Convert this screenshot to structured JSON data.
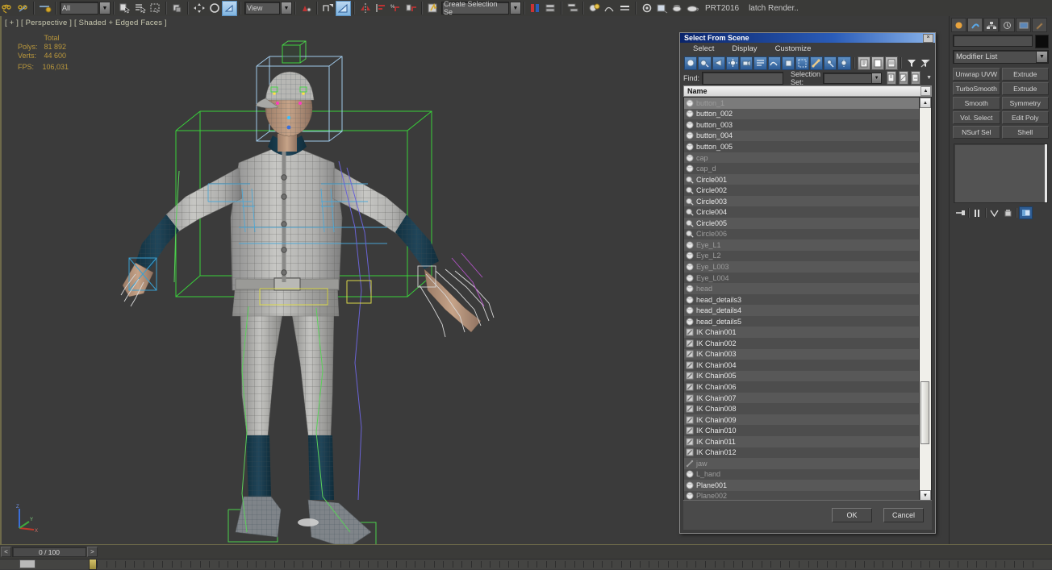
{
  "app": {
    "viewport_label": "[ + ] [ Perspective ] [ Shaded + Edged Faces ]",
    "stats": {
      "total_label": "Total",
      "polys_label": "Polys:",
      "polys_value": "81 892",
      "verts_label": "Verts:",
      "verts_value": "44 600",
      "fps_label": "FPS:",
      "fps_value": "106,031"
    }
  },
  "toolbar": {
    "filter_value": "All",
    "ref_coord_value": "View",
    "selection_set_value": "Create Selection Se",
    "render_preset": "PRT2016",
    "render_label": "latch Render..",
    "icons": [
      "undo-icon",
      "redo-icon",
      "select-link-icon",
      "unlink-icon",
      "bind-spacewarp-icon",
      "select-object-icon",
      "select-by-name-icon",
      "select-region-icon",
      "window-crossing-icon",
      "select-move-icon",
      "select-rotate-icon",
      "select-scale-icon",
      "mirror-icon",
      "align-icon",
      "layer-manager-icon",
      "graph-editor-icon",
      "schematic-view-icon",
      "material-editor-icon",
      "render-setup-icon",
      "render-frame-icon",
      "render-production-icon"
    ]
  },
  "command_panel": {
    "tabs": [
      "create-tab",
      "modify-tab",
      "hierarchy-tab",
      "motion-tab",
      "display-tab",
      "utilities-tab"
    ],
    "object_name": "",
    "modifier_list_label": "Modifier List",
    "stack_buttons": [
      "Unwrap UVW",
      "Extrude",
      "TurboSmooth",
      "Extrude",
      "Smooth",
      "Symmetry",
      "Vol. Select",
      "Edit Poly",
      "NSurf Sel",
      "Shell"
    ],
    "stack_tools": [
      "pin-stack-icon",
      "show-end-result-icon",
      "make-unique-icon",
      "remove-modifier-icon",
      "configure-sets-icon"
    ]
  },
  "dialog": {
    "title": "Select From Scene",
    "close_label": "×",
    "menu": [
      "Select",
      "Display",
      "Customize"
    ],
    "toolbar_icons": [
      "display-all-icon",
      "display-geometry-icon",
      "display-shapes-icon",
      "display-lights-icon",
      "display-cameras-icon",
      "display-helpers-icon",
      "display-spacewarps-icon",
      "display-groups-icon",
      "display-xrefs-icon",
      "display-bones-icon",
      "display-children-icon",
      "display-influences-icon",
      "list-types-icon",
      "sort-alphabetical-icon",
      "sort-by-type-icon",
      "filter-icon",
      "clear-filter-icon"
    ],
    "find_label": "Find:",
    "find_value": "",
    "find_placeholder": "",
    "selection_set_label": "Selection Set:",
    "selection_set_value": "",
    "column_header": "Name",
    "ok_label": "OK",
    "cancel_label": "Cancel",
    "items": [
      {
        "name": "button_1",
        "icon": "geometry-icon",
        "selected": true,
        "dim": true
      },
      {
        "name": "button_002",
        "icon": "geometry-icon",
        "selected": false,
        "dim": false
      },
      {
        "name": "button_003",
        "icon": "geometry-icon",
        "selected": false,
        "dim": false
      },
      {
        "name": "button_004",
        "icon": "geometry-icon",
        "selected": false,
        "dim": false
      },
      {
        "name": "button_005",
        "icon": "geometry-icon",
        "selected": false,
        "dim": false
      },
      {
        "name": "cap",
        "icon": "geometry-icon",
        "selected": false,
        "dim": true
      },
      {
        "name": "cap_d",
        "icon": "geometry-icon",
        "selected": false,
        "dim": true
      },
      {
        "name": "Circle001",
        "icon": "shape-icon",
        "selected": false,
        "dim": false
      },
      {
        "name": "Circle002",
        "icon": "shape-icon",
        "selected": false,
        "dim": false
      },
      {
        "name": "Circle003",
        "icon": "shape-icon",
        "selected": false,
        "dim": false
      },
      {
        "name": "Circle004",
        "icon": "shape-icon",
        "selected": false,
        "dim": false
      },
      {
        "name": "Circle005",
        "icon": "shape-icon",
        "selected": false,
        "dim": false
      },
      {
        "name": "Circle006",
        "icon": "shape-icon",
        "selected": false,
        "dim": true
      },
      {
        "name": "Eye_L1",
        "icon": "geometry-icon",
        "selected": false,
        "dim": true
      },
      {
        "name": "Eye_L2",
        "icon": "geometry-icon",
        "selected": false,
        "dim": true
      },
      {
        "name": "Eye_L003",
        "icon": "geometry-icon",
        "selected": false,
        "dim": true
      },
      {
        "name": "Eye_L004",
        "icon": "geometry-icon",
        "selected": false,
        "dim": true
      },
      {
        "name": "head",
        "icon": "geometry-icon",
        "selected": false,
        "dim": true
      },
      {
        "name": "head_details3",
        "icon": "geometry-icon",
        "selected": false,
        "dim": false
      },
      {
        "name": "head_details4",
        "icon": "geometry-icon",
        "selected": false,
        "dim": false
      },
      {
        "name": "head_details5",
        "icon": "geometry-icon",
        "selected": false,
        "dim": false
      },
      {
        "name": "IK Chain001",
        "icon": "ikchain-icon",
        "selected": false,
        "dim": false
      },
      {
        "name": "IK Chain002",
        "icon": "ikchain-icon",
        "selected": false,
        "dim": false
      },
      {
        "name": "IK Chain003",
        "icon": "ikchain-icon",
        "selected": false,
        "dim": false
      },
      {
        "name": "IK Chain004",
        "icon": "ikchain-icon",
        "selected": false,
        "dim": false
      },
      {
        "name": "IK Chain005",
        "icon": "ikchain-icon",
        "selected": false,
        "dim": false
      },
      {
        "name": "IK Chain006",
        "icon": "ikchain-icon",
        "selected": false,
        "dim": false
      },
      {
        "name": "IK Chain007",
        "icon": "ikchain-icon",
        "selected": false,
        "dim": false
      },
      {
        "name": "IK Chain008",
        "icon": "ikchain-icon",
        "selected": false,
        "dim": false
      },
      {
        "name": "IK Chain009",
        "icon": "ikchain-icon",
        "selected": false,
        "dim": false
      },
      {
        "name": "IK Chain010",
        "icon": "ikchain-icon",
        "selected": false,
        "dim": false
      },
      {
        "name": "IK Chain011",
        "icon": "ikchain-icon",
        "selected": false,
        "dim": false
      },
      {
        "name": "IK Chain012",
        "icon": "ikchain-icon",
        "selected": false,
        "dim": false
      },
      {
        "name": "jaw",
        "icon": "bone-icon",
        "selected": false,
        "dim": true
      },
      {
        "name": "L_hand",
        "icon": "geometry-icon",
        "selected": false,
        "dim": true
      },
      {
        "name": "Plane001",
        "icon": "geometry-icon",
        "selected": false,
        "dim": false
      },
      {
        "name": "Plane002",
        "icon": "geometry-icon",
        "selected": false,
        "dim": true
      }
    ]
  },
  "timeline": {
    "prev_label": "<",
    "next_label": ">",
    "frame_value": "0 / 100"
  },
  "colors": {
    "accent": "#2a5cb8",
    "stats_text": "#b9973c",
    "viewport_bg": "#3b3b3b",
    "panel_bg": "#3b3b3b"
  }
}
